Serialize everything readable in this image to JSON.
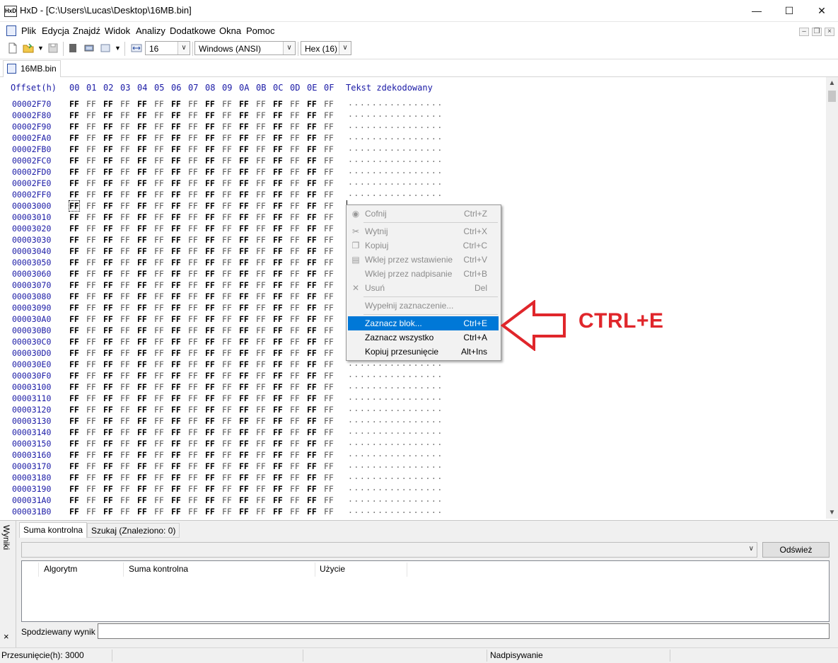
{
  "window": {
    "app_icon_text": "HxD",
    "title": "HxD - [C:\\Users\\Lucas\\Desktop\\16MB.bin]",
    "minimize": "—",
    "maximize": "☐",
    "close": "✕"
  },
  "menu": {
    "items": [
      "Plik",
      "Edycja",
      "Znajdź",
      "Widok",
      "Analizy",
      "Dodatkowe",
      "Okna",
      "Pomoc"
    ],
    "mdi_minimize": "–",
    "mdi_restore": "❐",
    "mdi_close": "×"
  },
  "toolbar": {
    "bytes_per_row": "16",
    "charset": "Windows (ANSI)",
    "offset_base": "Hex (16)",
    "dropdown_arrow": "∨"
  },
  "tab": {
    "label": "16MB.bin"
  },
  "hex": {
    "offset_header": "Offset(h)",
    "columns": [
      "00",
      "01",
      "02",
      "03",
      "04",
      "05",
      "06",
      "07",
      "08",
      "09",
      "0A",
      "0B",
      "0C",
      "0D",
      "0E",
      "0F"
    ],
    "text_header": "Tekst zdekodowany",
    "byte_value": "FF",
    "text_value": "................",
    "caret_row": 9,
    "offsets": [
      "00002F70",
      "00002F80",
      "00002F90",
      "00002FA0",
      "00002FB0",
      "00002FC0",
      "00002FD0",
      "00002FE0",
      "00002FF0",
      "00003000",
      "00003010",
      "00003020",
      "00003030",
      "00003040",
      "00003050",
      "00003060",
      "00003070",
      "00003080",
      "00003090",
      "000030A0",
      "000030B0",
      "000030C0",
      "000030D0",
      "000030E0",
      "000030F0",
      "00003100",
      "00003110",
      "00003120",
      "00003130",
      "00003140",
      "00003150",
      "00003160",
      "00003170",
      "00003180",
      "00003190",
      "000031A0",
      "000031B0"
    ]
  },
  "context_menu": {
    "items": [
      {
        "label": "Cofnij",
        "shortcut": "Ctrl+Z",
        "icon": "undo-icon",
        "disabled": true
      },
      {
        "separator": true
      },
      {
        "label": "Wytnij",
        "shortcut": "Ctrl+X",
        "icon": "scissors-icon",
        "disabled": true
      },
      {
        "label": "Kopiuj",
        "shortcut": "Ctrl+C",
        "icon": "copy-icon",
        "disabled": true
      },
      {
        "label": "Wklej przez wstawienie",
        "shortcut": "Ctrl+V",
        "icon": "paste-icon",
        "disabled": true
      },
      {
        "label": "Wklej przez nadpisanie",
        "shortcut": "Ctrl+B",
        "icon": "",
        "disabled": true
      },
      {
        "label": "Usuń",
        "shortcut": "Del",
        "icon": "delete-icon",
        "disabled": true
      },
      {
        "separator": true
      },
      {
        "label": "Wypełnij zaznaczenie...",
        "shortcut": "",
        "icon": "",
        "disabled": true
      },
      {
        "separator": true
      },
      {
        "label": "Zaznacz blok...",
        "shortcut": "Ctrl+E",
        "icon": "",
        "disabled": false,
        "selected": true
      },
      {
        "label": "Zaznacz wszystko",
        "shortcut": "Ctrl+A",
        "icon": "",
        "disabled": false
      },
      {
        "label": "Kopiuj przesunięcie",
        "shortcut": "Alt+Ins",
        "icon": "",
        "disabled": false
      }
    ]
  },
  "annotation": {
    "text": "CTRL+E",
    "color": "#e0262b"
  },
  "panel": {
    "side_label": "Wyniki",
    "side_close": "×",
    "tabs": [
      "Suma kontrolna",
      "Szukaj (Znaleziono: 0)"
    ],
    "refresh_button": "Odśwież",
    "columns": [
      "Algorytm",
      "Suma kontrolna",
      "Użycie"
    ],
    "expected_label": "Spodziewany wynik",
    "expected_value": ""
  },
  "status": {
    "offset": "Przesunięcie(h): 3000",
    "mode": "Nadpisywanie"
  },
  "colors": {
    "offset_blue": "#1a1aa6",
    "selection_blue": "#0078d7"
  }
}
